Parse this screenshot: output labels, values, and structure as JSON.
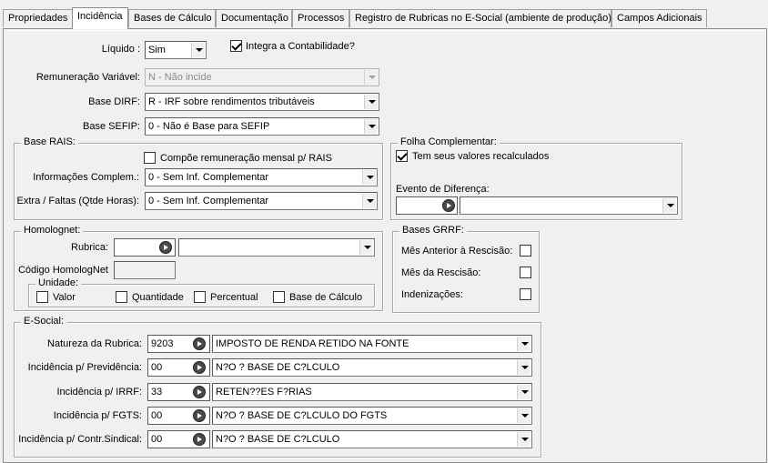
{
  "tabs": [
    {
      "label": "Propriedades",
      "active": false
    },
    {
      "label": "Incidência",
      "active": true
    },
    {
      "label": "Bases de Cálculo",
      "active": false
    },
    {
      "label": "Documentação",
      "active": false
    },
    {
      "label": "Processos",
      "active": false
    },
    {
      "label": "Registro de Rubricas no E-Social (ambiente de produção)",
      "active": false
    },
    {
      "label": "Campos Adicionais",
      "active": false
    }
  ],
  "main": {
    "liquido": {
      "label": "Líquido :",
      "value": "Sim"
    },
    "integra": {
      "label": "Integra a Contabilidade?",
      "checked": true
    },
    "remuneracao": {
      "label": "Remuneração Variável:",
      "value": "N - Não incide",
      "disabled": true
    },
    "base_dirf": {
      "label": "Base DIRF:",
      "value": "R - IRF sobre rendimentos tributáveis"
    },
    "base_sefip": {
      "label": "Base SEFIP:",
      "value": "0 - Não é Base para SEFIP"
    }
  },
  "rais": {
    "title": "Base RAIS:",
    "compoe": {
      "label": "Compõe remuneração mensal p/ RAIS",
      "checked": false
    },
    "info_compl": {
      "label": "Informações Complem.:",
      "value": "0 - Sem Inf. Complementar"
    },
    "extra_faltas": {
      "label": "Extra / Faltas (Qtde Horas):",
      "value": "0 - Sem Inf. Complementar"
    }
  },
  "folha": {
    "title": "Folha Complementar:",
    "recalc": {
      "label": "Tem seus valores recalculados",
      "checked": true
    },
    "evento_label": "Evento de Diferença:",
    "evento_code": "",
    "evento_value": ""
  },
  "homolognet": {
    "title": "Homolognet:",
    "rubrica_label": "Rubrica:",
    "rubrica_code": "",
    "rubrica_value": "",
    "codigo_label": "Código HomologNet",
    "codigo_value": "",
    "unidade": {
      "title": "Unidade:",
      "options": [
        {
          "label": "Valor",
          "checked": false
        },
        {
          "label": "Quantidade",
          "checked": false
        },
        {
          "label": "Percentual",
          "checked": false
        },
        {
          "label": "Base de Cálculo",
          "checked": false
        }
      ]
    }
  },
  "grrf": {
    "title": "Bases GRRF:",
    "items": [
      {
        "label": "Mês Anterior à Rescisão:",
        "checked": false
      },
      {
        "label": "Mês da Rescisão:",
        "checked": false
      },
      {
        "label": "Indenizações:",
        "checked": false
      }
    ]
  },
  "esocial": {
    "title": "E-Social:",
    "rows": [
      {
        "label": "Natureza da Rubrica:",
        "code": "9203",
        "value": "IMPOSTO DE RENDA RETIDO NA FONTE"
      },
      {
        "label": "Incidência p/ Previdência:",
        "code": "00",
        "value": "N?O ? BASE DE C?LCULO"
      },
      {
        "label": "Incidência p/ IRRF:",
        "code": "33",
        "value": "RETEN??ES F?RIAS"
      },
      {
        "label": "Incidência p/ FGTS:",
        "code": "00",
        "value": "N?O ? BASE DE C?LCULO DO FGTS"
      },
      {
        "label": "Incidência p/ Contr.Sindical:",
        "code": "00",
        "value": "N?O ? BASE DE C?LCULO"
      }
    ]
  }
}
